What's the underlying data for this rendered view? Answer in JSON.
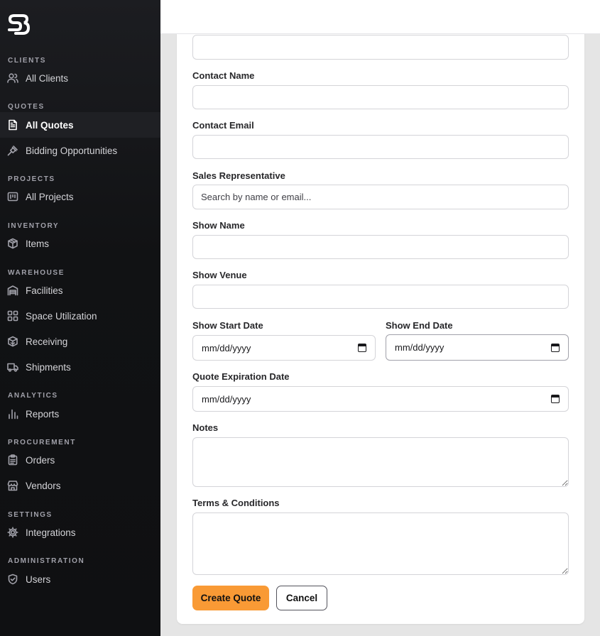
{
  "sidebar": {
    "logo": "SB logo",
    "sections": [
      {
        "label": "CLIENTS"
      },
      {
        "label": "QUOTES"
      },
      {
        "label": "PROJECTS"
      },
      {
        "label": "INVENTORY"
      },
      {
        "label": "WAREHOUSE"
      },
      {
        "label": "ANALYTICS"
      },
      {
        "label": "PROCUREMENT"
      },
      {
        "label": "SETTINGS"
      },
      {
        "label": "ADMINISTRATION"
      }
    ],
    "items": [
      {
        "label": "All Clients",
        "icon": "users-icon"
      },
      {
        "label": "All Quotes",
        "icon": "document-icon",
        "active": true
      },
      {
        "label": "Bidding Opportunities",
        "icon": "gavel-icon"
      },
      {
        "label": "All Projects",
        "icon": "kanban-icon"
      },
      {
        "label": "Items",
        "icon": "package-icon"
      },
      {
        "label": "Facilities",
        "icon": "warehouse-icon"
      },
      {
        "label": "Space Utilization",
        "icon": "grid-icon"
      },
      {
        "label": "Receiving",
        "icon": "box-in-icon"
      },
      {
        "label": "Shipments",
        "icon": "truck-icon"
      },
      {
        "label": "Reports",
        "icon": "bar-chart-icon"
      },
      {
        "label": "Orders",
        "icon": "clipboard-icon"
      },
      {
        "label": "Vendors",
        "icon": "store-icon"
      },
      {
        "label": "Integrations",
        "icon": "gear-icon"
      },
      {
        "label": "Users",
        "icon": "shield-icon"
      }
    ]
  },
  "form": {
    "contact_name_label": "Contact Name",
    "contact_email_label": "Contact Email",
    "sales_rep_label": "Sales Representative",
    "sales_rep_placeholder": "Search by name or email...",
    "show_name_label": "Show Name",
    "show_venue_label": "Show Venue",
    "show_start_label": "Show Start Date",
    "show_end_label": "Show End Date",
    "quote_exp_label": "Quote Expiration Date",
    "date_placeholder": "mm/dd/yyyy",
    "notes_label": "Notes",
    "terms_label": "Terms & Conditions"
  },
  "actions": {
    "create_label": "Create Quote",
    "cancel_label": "Cancel"
  },
  "colors": {
    "accent": "#f99a35",
    "sidebar_bg": "#111214"
  }
}
